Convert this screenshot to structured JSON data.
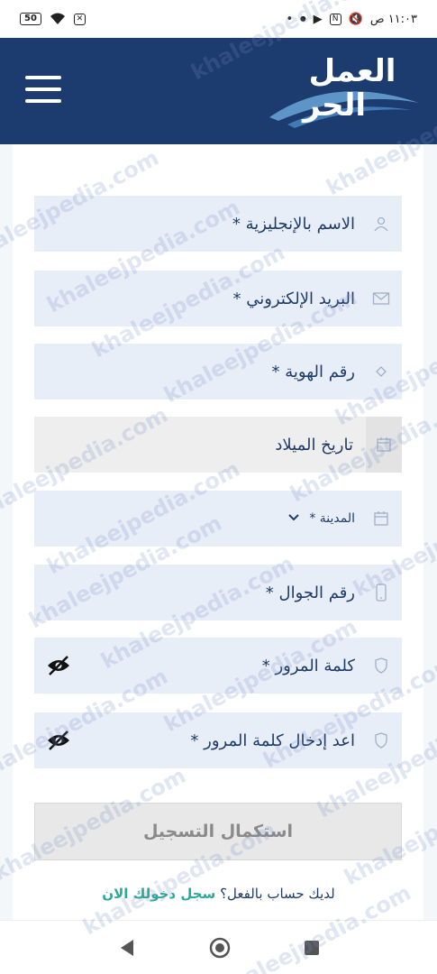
{
  "status_bar": {
    "time": "١١:٠٣ ص",
    "battery": "50"
  },
  "header": {
    "logo_line1": "العمل",
    "logo_line2": "الحر"
  },
  "form": {
    "fields": [
      {
        "label": "الاسم بالإنجليزية *",
        "icon": "user-icon"
      },
      {
        "label": "البريد الإلكتروني *",
        "icon": "mail-icon"
      },
      {
        "label": "رقم الهوية *",
        "icon": "id-card-icon"
      },
      {
        "label": "تاريخ الميلاد",
        "icon": "calendar-icon"
      },
      {
        "label": "المدينة *",
        "icon": "calendar-icon"
      },
      {
        "label": "رقم الجوال *",
        "icon": "phone-icon"
      },
      {
        "label": "كلمة المرور *",
        "icon": "shield-icon"
      },
      {
        "label": "اعد إدخال كلمة المرور *",
        "icon": "shield-icon"
      }
    ],
    "submit_label": "استكمال التسجيل",
    "login_prompt": "لديك حساب بالفعل؟",
    "login_link": "سجل دخولك الان"
  },
  "watermark": "khaleejpedia.com",
  "colors": {
    "header": "#1c3b6e",
    "field_bg": "#e8eef7",
    "text": "#1f3c68",
    "link": "#2aa89a"
  }
}
